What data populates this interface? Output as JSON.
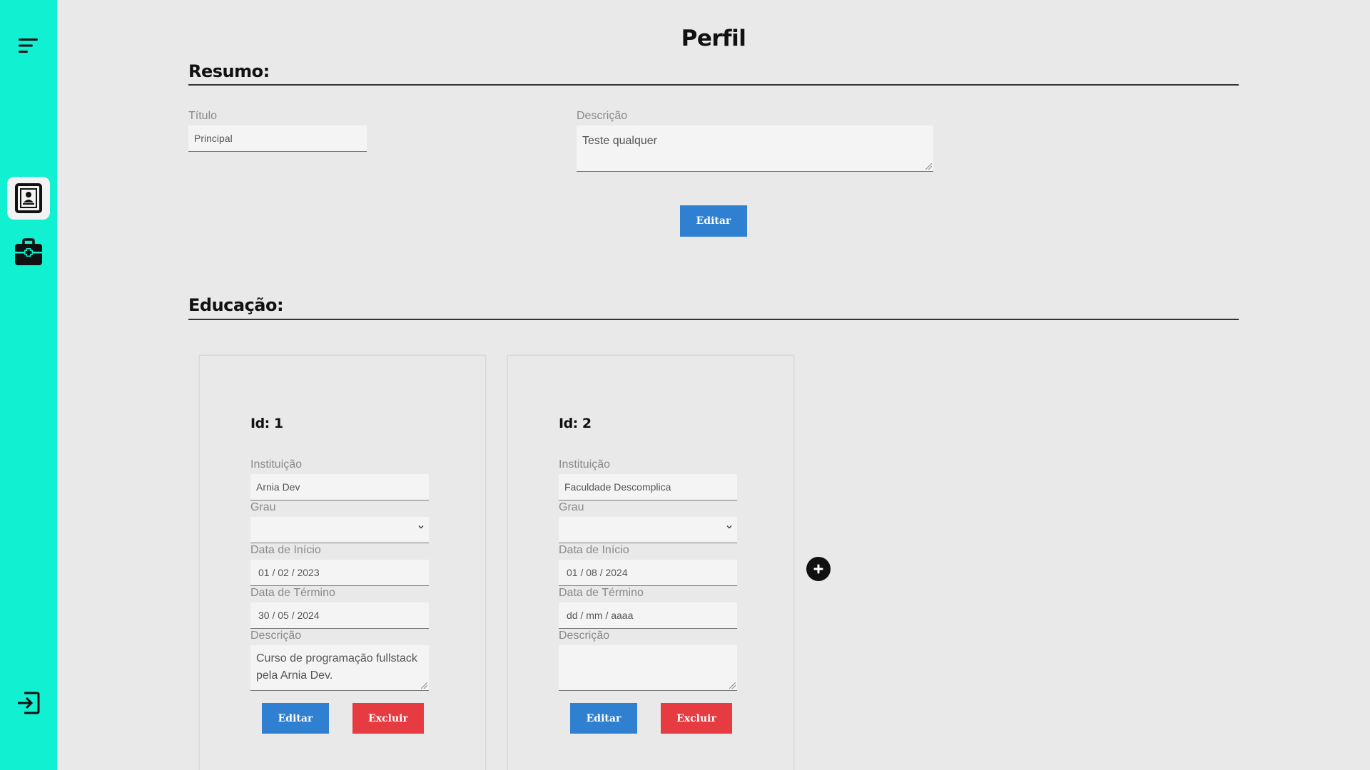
{
  "page": {
    "title": "Perfil"
  },
  "summary": {
    "heading": "Resumo:",
    "title_label": "Título",
    "title_value": "Principal",
    "description_label": "Descrição",
    "description_value": "Teste qualquer",
    "edit_label": "Editar"
  },
  "education": {
    "heading": "Educação:",
    "cards": [
      {
        "id_label": "Id: 1",
        "institution_label": "Instituição",
        "institution_value": "Arnia Dev",
        "degree_label": "Grau",
        "degree_value": "",
        "start_label": "Data de Início",
        "start_value": "01 / 02 / 2023",
        "end_label": "Data de Término",
        "end_value": "30 / 05 / 2024",
        "description_label": "Descrição",
        "description_value": "Curso de programação fullstack pela Arnia Dev.",
        "edit_label": "Editar",
        "delete_label": "Excluir"
      },
      {
        "id_label": "Id: 2",
        "institution_label": "Instituição",
        "institution_value": "Faculdade Descomplica",
        "degree_label": "Grau",
        "degree_value": "",
        "start_label": "Data de Início",
        "start_value": "01 / 08 / 2024",
        "end_label": "Data de Término",
        "end_value": "dd / mm / aaaa",
        "description_label": "Descrição",
        "description_value": "",
        "edit_label": "Editar",
        "delete_label": "Excluir"
      }
    ]
  },
  "sidebar": {
    "icons": [
      "menu-icon",
      "profile-card-icon",
      "briefcase-icon",
      "logout-icon"
    ]
  },
  "colors": {
    "sidebar": "#12f0d2",
    "primary_button": "#2f80d1",
    "danger_button": "#e63b41",
    "background": "#e9e9e9"
  }
}
